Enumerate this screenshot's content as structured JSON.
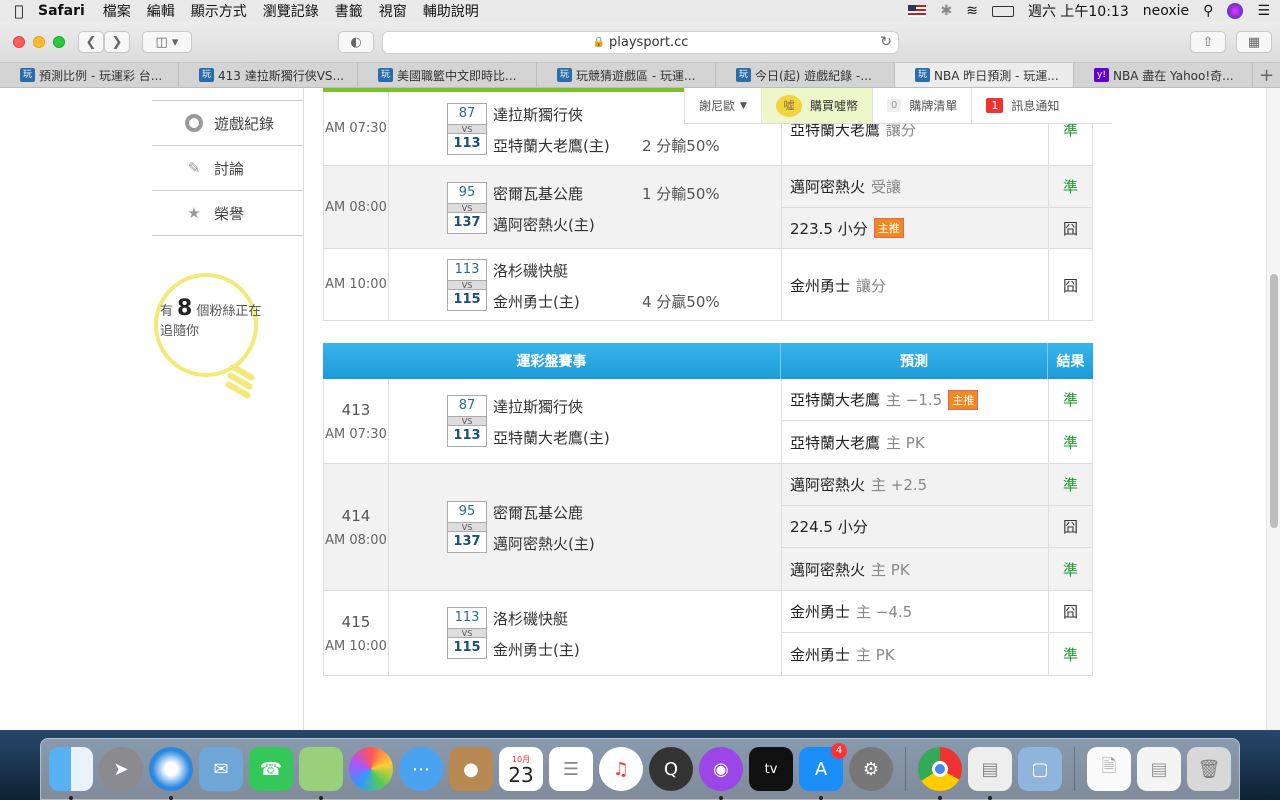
{
  "menubar": {
    "app": "Safari",
    "items": [
      "檔案",
      "編輯",
      "顯示方式",
      "瀏覽記錄",
      "書籤",
      "視窗",
      "輔助說明"
    ],
    "clock": "週六 上午10:13",
    "user": "neoxie"
  },
  "browser": {
    "url": "playsport.cc",
    "tabs": [
      {
        "title": "預測比例 - 玩運彩 台...",
        "fav": "玩"
      },
      {
        "title": "413 達拉斯獨行俠VS...",
        "fav": "玩"
      },
      {
        "title": "美國職籃中文即時比...",
        "fav": "玩"
      },
      {
        "title": "玩競猜遊戲區 - 玩運...",
        "fav": "玩"
      },
      {
        "title": "今日(起) 遊戲紀錄 -...",
        "fav": "玩"
      },
      {
        "title": "NBA 昨日預測 - 玩運...",
        "fav": "玩"
      },
      {
        "title": "NBA 盡在 Yahoo!奇...",
        "fav": "y!"
      }
    ]
  },
  "topnav": {
    "user": "謝尼歐",
    "coin": "購買噓幣",
    "coin_icon": "噓",
    "cart_count": "0",
    "cart": "購牌清單",
    "msg_count": "1",
    "msg": "訊息通知"
  },
  "sidebar": {
    "items": [
      {
        "label": "遊戲紀錄",
        "icon": "ring-icon"
      },
      {
        "label": "討論",
        "icon": "discussion-icon"
      },
      {
        "label": "榮譽",
        "icon": "medal-icon"
      }
    ],
    "fans_prefix": "有",
    "fans_count": "8",
    "fans_suffix": "個粉絲正在追隨你"
  },
  "table1": {
    "rows": [
      {
        "time": "AM 07:30",
        "away_score": "87",
        "home_score": "113",
        "away": "達拉斯獨行俠",
        "home": "亞特蘭大老鷹(主)",
        "note": "2 分輸50%",
        "note_row": "home",
        "preds": [
          {
            "main": "亞特蘭大老鷹",
            "sub": "讓分",
            "tag": "",
            "result": "準"
          }
        ]
      },
      {
        "time": "AM 08:00",
        "away_score": "95",
        "home_score": "137",
        "away": "密爾瓦基公鹿",
        "home": "邁阿密熱火(主)",
        "note": "1 分輸50%",
        "note_row": "away",
        "preds": [
          {
            "main": "邁阿密熱火",
            "sub": "受讓",
            "tag": "",
            "result": "準"
          },
          {
            "main": "223.5 小分",
            "sub": "",
            "tag": "主推",
            "result": "囧"
          }
        ]
      },
      {
        "time": "AM 10:00",
        "away_score": "113",
        "home_score": "115",
        "away": "洛杉磯快艇",
        "home": "金州勇士(主)",
        "note": "4 分贏50%",
        "note_row": "home",
        "preds": [
          {
            "main": "金州勇士",
            "sub": "讓分",
            "tag": "",
            "result": "囧"
          }
        ]
      }
    ]
  },
  "table2": {
    "header": {
      "game": "運彩盤賽事",
      "pred": "預測",
      "result": "結果"
    },
    "rows": [
      {
        "no": "413",
        "time": "AM 07:30",
        "away_score": "87",
        "home_score": "113",
        "away": "達拉斯獨行俠",
        "home": "亞特蘭大老鷹(主)",
        "preds": [
          {
            "main": "亞特蘭大老鷹",
            "sub": "主 −1.5",
            "tag": "主推",
            "result": "準"
          },
          {
            "main": "亞特蘭大老鷹",
            "sub": "主 PK",
            "tag": "",
            "result": "準"
          }
        ]
      },
      {
        "no": "414",
        "time": "AM 08:00",
        "away_score": "95",
        "home_score": "137",
        "away": "密爾瓦基公鹿",
        "home": "邁阿密熱火(主)",
        "preds": [
          {
            "main": "邁阿密熱火",
            "sub": "主 +2.5",
            "tag": "",
            "result": "準"
          },
          {
            "main": "224.5 小分",
            "sub": "",
            "tag": "",
            "result": "囧"
          },
          {
            "main": "邁阿密熱火",
            "sub": "主 PK",
            "tag": "",
            "result": "準"
          }
        ]
      },
      {
        "no": "415",
        "time": "AM 10:00",
        "away_score": "113",
        "home_score": "115",
        "away": "洛杉磯快艇",
        "home": "金州勇士(主)",
        "preds": [
          {
            "main": "金州勇士",
            "sub": "主 −4.5",
            "tag": "",
            "result": "囧"
          },
          {
            "main": "金州勇士",
            "sub": "主 PK",
            "tag": "",
            "result": "準"
          }
        ]
      }
    ]
  },
  "vs_label": "VS",
  "dock": {
    "apps": [
      "Finder",
      "Launchpad",
      "Safari",
      "Mail",
      "FaceTime",
      "Maps",
      "Photos",
      "Messages",
      "Contacts",
      "Calendar",
      "Reminders",
      "Music",
      "QuickTime",
      "Podcasts",
      "TV",
      "App Store",
      "System Preferences",
      "Chrome",
      "Preview",
      "Image Capture",
      "Documents",
      "Screenshot",
      "Trash"
    ],
    "calendar_month": "10月",
    "calendar_day": "23",
    "appstore_badge": "4",
    "tv_label": "tv"
  },
  "colors": {
    "accent": "#1e9ad8",
    "win": "#1a9a2a",
    "tag": "#f08a20",
    "green_bar": "#77c227"
  }
}
